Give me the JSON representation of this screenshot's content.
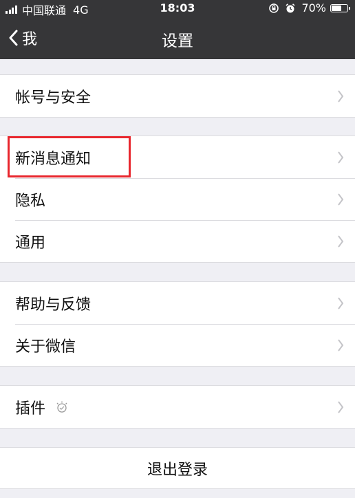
{
  "status": {
    "carrier": "中国联通",
    "network": "4G",
    "time": "18:03",
    "battery_pct": "70%",
    "battery_level": 0.7
  },
  "nav": {
    "back_label": "我",
    "title": "设置"
  },
  "groups": [
    {
      "items": [
        {
          "label": "帐号与安全"
        }
      ]
    },
    {
      "items": [
        {
          "label": "新消息通知"
        },
        {
          "label": "隐私"
        },
        {
          "label": "通用"
        }
      ]
    },
    {
      "items": [
        {
          "label": "帮助与反馈"
        },
        {
          "label": "关于微信"
        }
      ]
    },
    {
      "items": [
        {
          "label": "插件"
        }
      ]
    }
  ],
  "logout_label": "退出登录",
  "colors": {
    "navbar": "#363638",
    "background": "#efeff4",
    "highlight": "#e8262d"
  }
}
